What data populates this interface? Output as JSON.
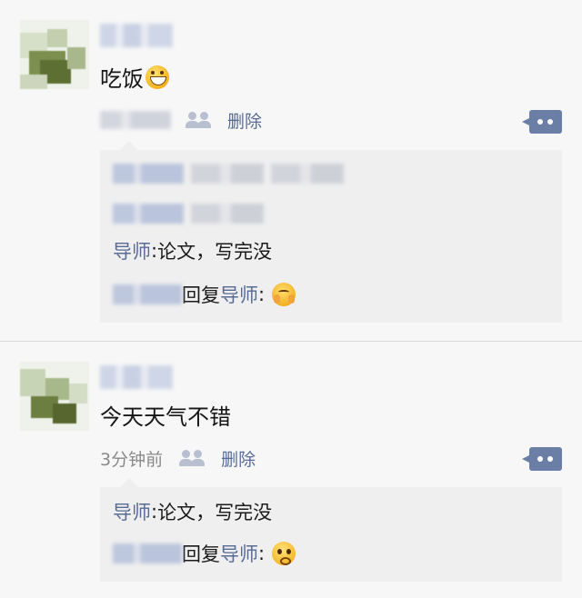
{
  "posts": [
    {
      "content": "吃饭",
      "content_emoji": "grinning-face-emoji",
      "time": "",
      "delete_label": "删除",
      "comments": [
        {
          "type": "blurred"
        },
        {
          "type": "blurred"
        },
        {
          "type": "comment",
          "author": "导师",
          "sep": ": ",
          "text": "论文，写完没"
        },
        {
          "type": "reply",
          "reply_word": "回复",
          "to": "导师",
          "sep": ": ",
          "emoji": "shy-face-emoji"
        }
      ]
    },
    {
      "content": "今天天气不错",
      "time": "3分钟前",
      "delete_label": "删除",
      "comments": [
        {
          "type": "comment",
          "author": "导师",
          "sep": ": ",
          "text": "论文，写完没"
        },
        {
          "type": "reply",
          "reply_word": "回复",
          "to": "导师",
          "sep": ": ",
          "emoji": "worried-face-emoji"
        }
      ]
    }
  ],
  "colors": {
    "link": "#576b95",
    "action_button": "#6a7ea6",
    "background": "#f7f7f7",
    "comment_bg": "#efefef"
  }
}
